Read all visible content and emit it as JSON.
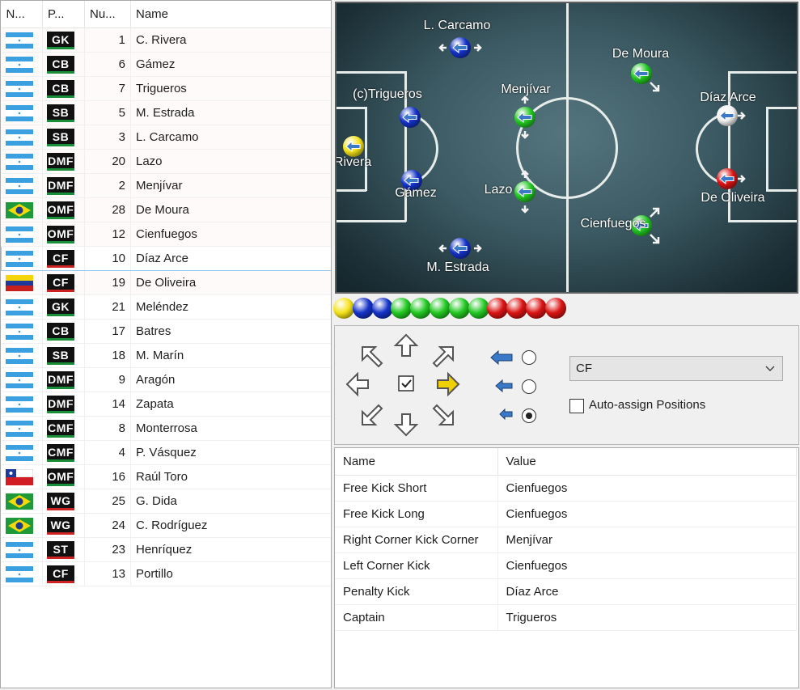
{
  "roster": {
    "columns": [
      "N...",
      "P...",
      "Nu...",
      "Name"
    ],
    "rows": [
      {
        "flag": "honduras",
        "pos": "GK",
        "pos_color": "#1a8f3a",
        "num": "1",
        "name": "C. Rivera"
      },
      {
        "flag": "honduras",
        "pos": "CB",
        "pos_color": "#1a8f3a",
        "num": "6",
        "name": "Gámez"
      },
      {
        "flag": "honduras",
        "pos": "CB",
        "pos_color": "#1a8f3a",
        "num": "7",
        "name": "Trigueros"
      },
      {
        "flag": "honduras",
        "pos": "SB",
        "pos_color": "#1a8f3a",
        "num": "5",
        "name": "M. Estrada"
      },
      {
        "flag": "honduras",
        "pos": "SB",
        "pos_color": "#1a8f3a",
        "num": "3",
        "name": "L. Carcamo"
      },
      {
        "flag": "honduras",
        "pos": "DMF",
        "pos_color": "#1a8f3a",
        "num": "20",
        "name": "Lazo"
      },
      {
        "flag": "honduras",
        "pos": "DMF",
        "pos_color": "#1a8f3a",
        "num": "2",
        "name": "Menjívar"
      },
      {
        "flag": "brazil",
        "pos": "OMF",
        "pos_color": "#1a8f3a",
        "num": "28",
        "name": "De Moura"
      },
      {
        "flag": "honduras",
        "pos": "OMF",
        "pos_color": "#1a8f3a",
        "num": "12",
        "name": "Cienfuegos"
      },
      {
        "flag": "honduras",
        "pos": "CF",
        "pos_color": "#c22",
        "num": "10",
        "name": "Díaz Arce"
      },
      {
        "flag": "venezuela",
        "pos": "CF",
        "pos_color": "#c22",
        "num": "19",
        "name": "De Oliveira"
      },
      {
        "flag": "honduras",
        "pos": "GK",
        "pos_color": "#1a8f3a",
        "num": "21",
        "name": "Meléndez"
      },
      {
        "flag": "honduras",
        "pos": "CB",
        "pos_color": "#1a8f3a",
        "num": "17",
        "name": "Batres"
      },
      {
        "flag": "honduras",
        "pos": "SB",
        "pos_color": "#1a8f3a",
        "num": "18",
        "name": "M. Marín"
      },
      {
        "flag": "honduras",
        "pos": "DMF",
        "pos_color": "#1a8f3a",
        "num": "9",
        "name": "Aragón"
      },
      {
        "flag": "honduras",
        "pos": "DMF",
        "pos_color": "#1a8f3a",
        "num": "14",
        "name": "Zapata"
      },
      {
        "flag": "honduras",
        "pos": "CMF",
        "pos_color": "#1a8f3a",
        "num": "8",
        "name": "Monterrosa"
      },
      {
        "flag": "honduras",
        "pos": "CMF",
        "pos_color": "#1a8f3a",
        "num": "4",
        "name": "P. Vásquez"
      },
      {
        "flag": "chile",
        "pos": "OMF",
        "pos_color": "#1a8f3a",
        "num": "16",
        "name": "Raúl Toro"
      },
      {
        "flag": "brazil",
        "pos": "WG",
        "pos_color": "#c22",
        "num": "25",
        "name": "G. Dida"
      },
      {
        "flag": "brazil",
        "pos": "WG",
        "pos_color": "#c22",
        "num": "24",
        "name": "C. Rodríguez"
      },
      {
        "flag": "honduras",
        "pos": "ST",
        "pos_color": "#c22",
        "num": "23",
        "name": "Henríquez"
      },
      {
        "flag": "honduras",
        "pos": "CF",
        "pos_color": "#c22",
        "num": "13",
        "name": "Portillo"
      }
    ],
    "selected_row": "Díaz Arce"
  },
  "pitch": {
    "players": [
      {
        "label": "L. Carcamo",
        "color": "blue",
        "arrows": "left-right"
      },
      {
        "label": "(c)Trigueros",
        "color": "blue",
        "arrows": "none"
      },
      {
        "label": "C.Rivera",
        "color": "yellow",
        "arrows": "none"
      },
      {
        "label": "Gámez",
        "color": "blue",
        "arrows": "none"
      },
      {
        "label": "M. Estrada",
        "color": "blue",
        "arrows": "left-right"
      },
      {
        "label": "Menjívar",
        "color": "green",
        "arrows": "up-down"
      },
      {
        "label": "Lazo",
        "color": "green",
        "arrows": "up-down"
      },
      {
        "label": "De Moura",
        "color": "green",
        "arrows": "down-right"
      },
      {
        "label": "Cienfuegos",
        "color": "green",
        "arrows": "up-right-down-right"
      },
      {
        "label": "Díaz Arce",
        "color": "white",
        "arrows": "right"
      },
      {
        "label": "De Oliveira",
        "color": "red",
        "arrows": "right"
      }
    ]
  },
  "ball_strip": [
    "yellow",
    "blue",
    "blue",
    "green",
    "green",
    "green",
    "green",
    "green",
    "red",
    "red",
    "red",
    "red"
  ],
  "colors": {
    "yellow": "#f4e21a",
    "blue": "#1432c8",
    "green": "#22c822",
    "red": "#dc1414",
    "white": "#f2f2f2",
    "selection_border": "#99c9ef",
    "arrow_blue": "#3a78c8",
    "arrow_yellow": "#f0d000"
  },
  "controls": {
    "direction_icons": [
      "arrow-up-left-icon",
      "arrow-up-icon",
      "arrow-up-right-icon",
      "arrow-left-icon",
      "checkbox-center-icon",
      "arrow-right-icon",
      "arrow-down-left-icon",
      "arrow-down-icon",
      "arrow-down-right-icon"
    ],
    "active_direction": "right",
    "center_checked": true,
    "arrow_sizes": [
      "large",
      "medium",
      "small"
    ],
    "selected_arrow_size": "small",
    "position_select_value": "CF",
    "auto_assign_label": "Auto-assign Positions",
    "auto_assign_checked": false
  },
  "set_pieces": {
    "columns": [
      "Name",
      "Value"
    ],
    "rows": [
      {
        "name": "Free Kick Short",
        "value": "Cienfuegos"
      },
      {
        "name": "Free Kick Long",
        "value": "Cienfuegos"
      },
      {
        "name": "Right Corner Kick Corner",
        "value": "Menjívar"
      },
      {
        "name": "Left Corner Kick",
        "value": "Cienfuegos"
      },
      {
        "name": "Penalty Kick",
        "value": "Díaz Arce"
      },
      {
        "name": "Captain",
        "value": "Trigueros"
      }
    ]
  }
}
